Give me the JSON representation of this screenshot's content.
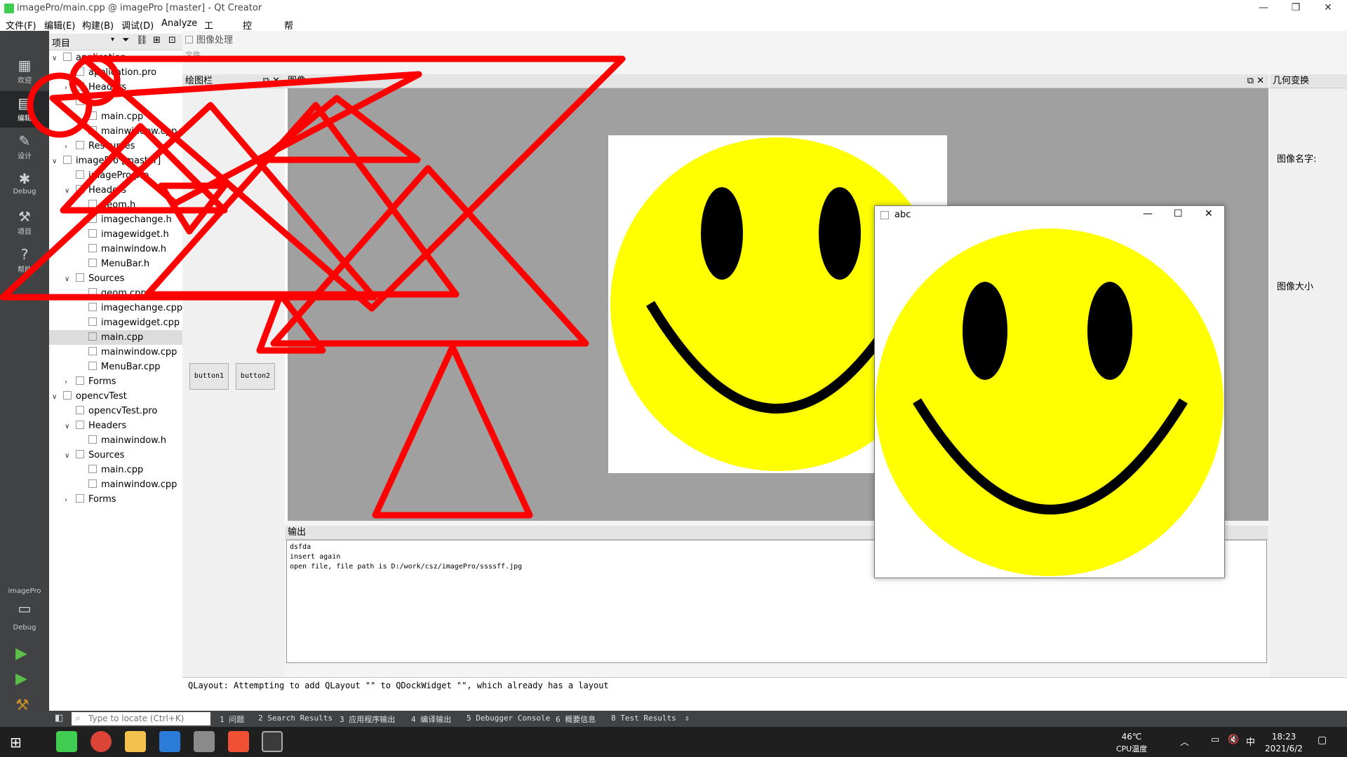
{
  "window": {
    "title": "imagePro/main.cpp @ imagePro [master] - Qt Creator",
    "minimize": "—",
    "maximize": "❐",
    "close": "✕"
  },
  "menubar": [
    "文件(F)",
    "编辑(E)",
    "构建(B)",
    "调试(D)",
    "Analyze",
    "工具(T)",
    "控件(W)",
    "帮助(H)"
  ],
  "modes": [
    {
      "label": "欢迎",
      "icon": "grid-icon"
    },
    {
      "label": "编辑",
      "icon": "edit-icon"
    },
    {
      "label": "设计",
      "icon": "pencil-icon"
    },
    {
      "label": "Debug",
      "icon": "bug-icon"
    },
    {
      "label": "项目",
      "icon": "wrench-icon"
    },
    {
      "label": "帮助",
      "icon": "help-icon"
    }
  ],
  "target": {
    "project": "imagePro",
    "config": "Debug"
  },
  "project_pane": {
    "title": "项目"
  },
  "tree": [
    {
      "label": "application",
      "level": 0,
      "arrow": "v"
    },
    {
      "label": "application.pro",
      "level": 1,
      "arrow": ""
    },
    {
      "label": "Headers",
      "level": 1,
      "arrow": ">"
    },
    {
      "label": "",
      "level": 1,
      "arrow": ""
    },
    {
      "label": "main.cpp",
      "level": 2,
      "arrow": ""
    },
    {
      "label": "mainwindow.cpp",
      "level": 2,
      "arrow": ""
    },
    {
      "label": "Resources",
      "level": 1,
      "arrow": ">"
    },
    {
      "label": "imagePro [master]",
      "level": 0,
      "arrow": "v"
    },
    {
      "label": "imagePro.pro",
      "level": 1,
      "arrow": ""
    },
    {
      "label": "Headers",
      "level": 1,
      "arrow": "v"
    },
    {
      "label": "geom.h",
      "level": 2,
      "arrow": ""
    },
    {
      "label": "imagechange.h",
      "level": 2,
      "arrow": ""
    },
    {
      "label": "imagewidget.h",
      "level": 2,
      "arrow": ""
    },
    {
      "label": "mainwindow.h",
      "level": 2,
      "arrow": ""
    },
    {
      "label": "MenuBar.h",
      "level": 2,
      "arrow": ""
    },
    {
      "label": "Sources",
      "level": 1,
      "arrow": "v"
    },
    {
      "label": "geom.cpp",
      "level": 2,
      "arrow": ""
    },
    {
      "label": "imagechange.cpp",
      "level": 2,
      "arrow": ""
    },
    {
      "label": "imagewidget.cpp",
      "level": 2,
      "arrow": ""
    },
    {
      "label": "main.cpp",
      "level": 2,
      "arrow": "",
      "selected": true
    },
    {
      "label": "mainwindow.cpp",
      "level": 2,
      "arrow": ""
    },
    {
      "label": "MenuBar.cpp",
      "level": 2,
      "arrow": ""
    },
    {
      "label": "Forms",
      "level": 1,
      "arrow": ">"
    },
    {
      "label": "opencvTest",
      "level": 0,
      "arrow": "v"
    },
    {
      "label": "opencvTest.pro",
      "level": 1,
      "arrow": ""
    },
    {
      "label": "Headers",
      "level": 1,
      "arrow": "v"
    },
    {
      "label": "mainwindow.h",
      "level": 2,
      "arrow": ""
    },
    {
      "label": "Sources",
      "level": 1,
      "arrow": "v"
    },
    {
      "label": "main.cpp",
      "level": 2,
      "arrow": ""
    },
    {
      "label": "mainwindow.cpp",
      "level": 2,
      "arrow": ""
    },
    {
      "label": "Forms",
      "level": 1,
      "arrow": ">"
    }
  ],
  "app": {
    "title": "图像处理",
    "menu_file": "文件",
    "draw_dock": "绘图栏",
    "image_dock": "图像",
    "output_dock": "输出",
    "geo_dock": "几何变换",
    "button1": "button1",
    "button2": "button2",
    "image_name_label": "图像名字:",
    "image_size_label": "图像大小",
    "output_lines": [
      "dsfda",
      "insert again",
      "open file, file path is D:/work/csz/imagePro/ssssff.jpg"
    ]
  },
  "popup": {
    "title": "abc"
  },
  "compile_message": "QLayout: Attempting to add QLayout \"\" to QDockWidget \"\", which already has a layout",
  "locator": {
    "placeholder": "Type to locate (Ctrl+K)"
  },
  "output_tabs": [
    "1 问题",
    "2 Search Results",
    "3 应用程序输出",
    "4 编译输出",
    "5 Debugger Console",
    "6 概要信息",
    "8 Test Results"
  ],
  "taskbar": {
    "temp": "46℃",
    "cpu": "CPU温度",
    "time": "18:23",
    "date": "2021/6/2",
    "ime": "中",
    "apps": [
      "qt-icon",
      "chrome-icon",
      "folder-icon",
      "app-icon",
      "vm-icon",
      "git-icon",
      "window-icon"
    ]
  },
  "colors": {
    "accent": "#41cd52",
    "drawing": "#ff0000",
    "smiley": "#ffff00"
  }
}
